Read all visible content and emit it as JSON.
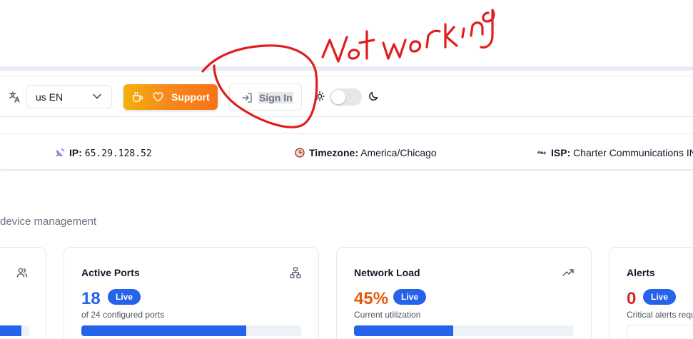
{
  "header": {
    "language_select": {
      "value": "us EN"
    },
    "support_button": {
      "label": "Support"
    },
    "signin_button": {
      "label": "Sign In"
    },
    "theme_toggle": {
      "state": "light"
    }
  },
  "infobar": {
    "ip": {
      "key": "IP:",
      "value": "65.29.128.52"
    },
    "timezone": {
      "key": "Timezone:",
      "value": "America/Chicago"
    },
    "isp": {
      "key": "ISP:",
      "value": "Charter Communications IN"
    }
  },
  "subtitle": "device management",
  "cards": {
    "ports": {
      "title": "Active Ports",
      "value": "18",
      "badge": "Live",
      "desc": "of 24 configured ports",
      "progress": 0.75,
      "value_color": "#2563eb"
    },
    "load": {
      "title": "Network Load",
      "value": "45%",
      "badge": "Live",
      "desc": "Current utilization",
      "progress": 0.45,
      "value_color": "#ea580c"
    },
    "alerts": {
      "title": "Alerts",
      "value": "0",
      "badge": "Live",
      "desc": "Critical alerts requ",
      "value_color": "#dc2626"
    },
    "users": {
      "progress": 0.8
    }
  },
  "annotation": {
    "text": "Not working",
    "color": "#e11d1d"
  },
  "colors": {
    "accent": "#2563eb",
    "support_start": "#f5b00b",
    "support_end": "#f97316"
  }
}
